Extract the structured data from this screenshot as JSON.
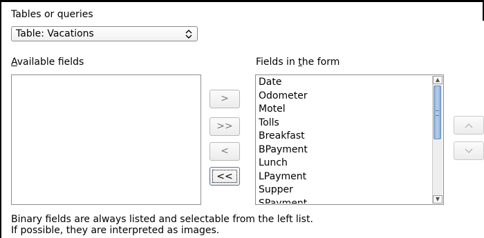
{
  "tables_or_queries": {
    "label": "Tables or queries",
    "selected": "Table: Vacations"
  },
  "available_fields": {
    "label": "Available fields",
    "items": []
  },
  "fields_in_form": {
    "label": "Fields in the form",
    "items": [
      "Date",
      "Odometer",
      "Motel",
      "Tolls",
      "Breakfast",
      "BPayment",
      "Lunch",
      "LPayment",
      "Supper",
      "SPayment"
    ]
  },
  "move_buttons": {
    "add_one": ">",
    "add_all": ">>",
    "remove_one": "<",
    "remove_all": "<<"
  },
  "order_buttons": {
    "up": "^",
    "down": "v"
  },
  "note": {
    "line1": "Binary fields are always listed and selectable from the left list.",
    "line2": "If possible, they are interpreted as images."
  }
}
